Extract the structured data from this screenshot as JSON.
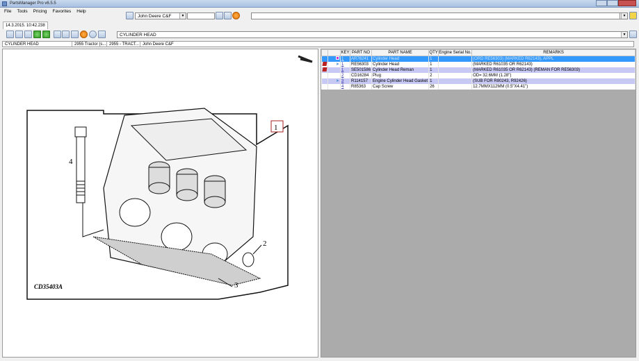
{
  "window": {
    "title": "PartsManager Pro v6.5.5"
  },
  "menu": [
    "File",
    "Tools",
    "Pricing",
    "Favorites",
    "Help"
  ],
  "catalog_select": "John Deere C&F",
  "tab": "14.3.2015. 10:42.238",
  "section_select": "CYLINDER HEAD",
  "breadcrumb": [
    "CYLINDER HEAD",
    "2955 Tractor (s...",
    "2955 - TRACT...",
    "John Deere C&F"
  ],
  "table": {
    "headers": [
      "",
      "",
      "KEY",
      "PART NO",
      "PART NAME",
      "QTY",
      "Engine Serial No.",
      "REMARKS"
    ],
    "rows": [
      {
        "key": "1",
        "part_no": "AR76241",
        "name": "Cylinder Head",
        "qty": "1",
        "serial": "",
        "remarks": "(ORD RE56303) (MARKED R62143), APPL",
        "style": "sel",
        "flag": false,
        "pin": false,
        "dot": true
      },
      {
        "key": "1",
        "part_no": "RE56303",
        "name": "Cylinder Head",
        "qty": "1",
        "serial": "",
        "remarks": "(MARKED R61035 OR R62143)",
        "style": "",
        "flag": true,
        "pin": true,
        "dot": false
      },
      {
        "key": "1",
        "part_no": "SE501586",
        "name": "Cylinder Head Reman",
        "qty": "1",
        "serial": "",
        "remarks": "(MARKED R61035 OR R62143) (REMAN FOR RE56303)",
        "style": "alt",
        "flag": true,
        "pin": false,
        "dot": false
      },
      {
        "key": "2",
        "part_no": "CD16284",
        "name": "Plug",
        "qty": "2",
        "serial": "",
        "remarks": "OD= 32.6MM (1.28\")",
        "style": "",
        "flag": false,
        "pin": false,
        "dot": false
      },
      {
        "key": "3",
        "part_no": "R114157",
        "name": "Engine Cylinder Head Gasket",
        "qty": "1",
        "serial": "",
        "remarks": "(SUB FOR R80243, R92426)",
        "style": "alt",
        "flag": false,
        "pin": true,
        "dot": false
      },
      {
        "key": "4",
        "part_no": "R85363",
        "name": "Cap Screw",
        "qty": "26",
        "serial": "",
        "remarks": "12.7MMX112MM (0.5\"X4.41\")",
        "style": "",
        "flag": false,
        "pin": false,
        "dot": false
      }
    ]
  },
  "diagram": {
    "labels": [
      "1",
      "2",
      "3",
      "4"
    ],
    "code": "CD35403A"
  }
}
